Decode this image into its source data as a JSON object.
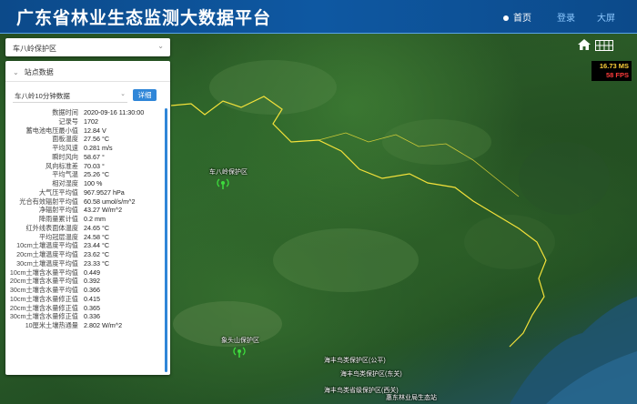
{
  "header": {
    "title": "广东省林业生态监测大数据平台",
    "nav": {
      "home": "首页",
      "login": "登录",
      "bigscreen": "大屏"
    }
  },
  "sidebar": {
    "reserve_select": "车八岭保护区",
    "data_section": "站点数据",
    "device_select": "车八岭10分钟数据",
    "detail_button": "详细",
    "rows": [
      {
        "k": "数据时间",
        "v": "2020-09-16 11:30:00"
      },
      {
        "k": "记录号",
        "v": "1702"
      },
      {
        "k": "蓄电池电压最小值",
        "v": "12.84 V"
      },
      {
        "k": "面板温度",
        "v": "27.56 °C"
      },
      {
        "k": "平均风速",
        "v": "0.281 m/s"
      },
      {
        "k": "瞬时风向",
        "v": "58.67 °"
      },
      {
        "k": "风向标准差",
        "v": "70.03 °"
      },
      {
        "k": "平均气温",
        "v": "25.26 °C"
      },
      {
        "k": "相对湿度",
        "v": "100 %"
      },
      {
        "k": "大气压平均值",
        "v": "967.9527 hPa"
      },
      {
        "k": "光合有效辐射平均值",
        "v": "60.58 umol/s/m^2"
      },
      {
        "k": "净辐射平均值",
        "v": "43.27 W/m^2"
      },
      {
        "k": "降雨量累计值",
        "v": "0.2 mm"
      },
      {
        "k": "红外线表面体温度",
        "v": "24.65 °C"
      },
      {
        "k": "平均冠层温度",
        "v": "24.58 °C"
      },
      {
        "k": "10cm土壤温度平均值",
        "v": "23.44 °C"
      },
      {
        "k": "20cm土壤温度平均值",
        "v": "23.62 °C"
      },
      {
        "k": "30cm土壤温度平均值",
        "v": "23.33 °C"
      },
      {
        "k": "10cm土壤含水量平均值",
        "v": "0.449"
      },
      {
        "k": "20cm土壤含水量平均值",
        "v": "0.392"
      },
      {
        "k": "30cm土壤含水量平均值",
        "v": "0.366"
      },
      {
        "k": "10cm土壤含水量修正值",
        "v": "0.415"
      },
      {
        "k": "20cm土壤含水量修正值",
        "v": "0.365"
      },
      {
        "k": "30cm土壤含水量修正值",
        "v": "0.336"
      },
      {
        "k": "10厘米土壤热通量",
        "v": "2.802 W/m^2"
      }
    ]
  },
  "map": {
    "fps_ms": "16.73 MS",
    "fps_fps": "58 FPS",
    "labels": {
      "chebaling": "车八岭保护区",
      "xiangtoushan": "象头山保护区",
      "neilingding": "海丰鸟类保护区(公平)",
      "neilingding2": "海丰鸟类保护区(东关)",
      "zhuhai": "海丰鸟类省级保护区(西关)",
      "forestry": "惠东林业局生态站"
    },
    "colors": {
      "boundary": "#f4e23a",
      "station": "#3ddc3d"
    }
  }
}
